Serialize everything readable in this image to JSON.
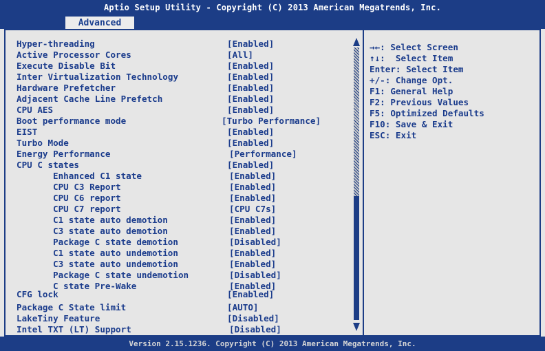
{
  "header": {
    "title": "Aptio Setup Utility - Copyright (C) 2013 American Megatrends, Inc.",
    "tab_label": "Advanced"
  },
  "settings": [
    {
      "label": "Hyper-threading",
      "value": "[Enabled]"
    },
    {
      "label": "Active Processor Cores",
      "value": "[All]"
    },
    {
      "label": "Execute Disable Bit",
      "value": "[Enabled]"
    },
    {
      "label": "Inter Virtualization Technology",
      "value": "[Enabled]"
    },
    {
      "label": "Hardware Prefetcher",
      "value": "[Enabled]"
    },
    {
      "label": "Adjacent Cache Line Prefetch",
      "value": "[Enabled]"
    },
    {
      "label": "CPU AES",
      "value": "[Enabled]"
    },
    {
      "label": "Boot performance mode",
      "value": "[Turbo Performance]"
    },
    {
      "label": "EIST",
      "value": "[Enabled]"
    },
    {
      "label": "Turbo Mode",
      "value": "[Enabled]"
    },
    {
      "label": "Energy Performance",
      "value": "[Performance]"
    },
    {
      "label": "CPU C states",
      "value": "[Enabled]"
    },
    {
      "label": "Enhanced C1 state",
      "value": "[Enabled]"
    },
    {
      "label": "CPU C3 Report",
      "value": "[Enabled]"
    },
    {
      "label": "CPU C6 report",
      "value": "[Enabled]"
    },
    {
      "label": "CPU C7 report",
      "value": "[CPU C7s]"
    },
    {
      "label": "C1 state auto demotion",
      "value": "[Enabled]"
    },
    {
      "label": "C3 state auto demotion",
      "value": "[Enabled]"
    },
    {
      "label": "Package C state demotion",
      "value": "[Disabled]"
    },
    {
      "label": "C1 state auto undemotion",
      "value": "[Enabled]"
    },
    {
      "label": "C3 state auto undemotion",
      "value": "[Enabled]"
    },
    {
      "label": "Package C state undemotion",
      "value": "[Disabled]"
    },
    {
      "label": "C state Pre-Wake",
      "value": "[Enabled]"
    },
    {
      "label": "CFG lock",
      "value": "[Enabled]"
    },
    {
      "label": "Package C State limit",
      "value": "[AUTO]"
    },
    {
      "label": "LakeTiny Feature",
      "value": "[Disabled]"
    },
    {
      "label": "Intel TXT (LT) Support",
      "value": "[Disabled]"
    }
  ],
  "help": [
    "→←: Select Screen",
    "↑↓:  Select Item",
    "Enter: Select Item",
    "+/-: Change Opt.",
    "F1: General Help",
    "F2: Previous Values",
    "F5: Optimized Defaults",
    "F10: Save & Exit",
    "ESC: Exit"
  ],
  "footer": {
    "version": "Version 2.15.1236. Copyright (C) 2013 American Megatrends, Inc."
  },
  "colors": {
    "primary_blue": "#1c3d86",
    "text_blue": "#1b3c8c",
    "background_gray": "#e6e6e6"
  }
}
